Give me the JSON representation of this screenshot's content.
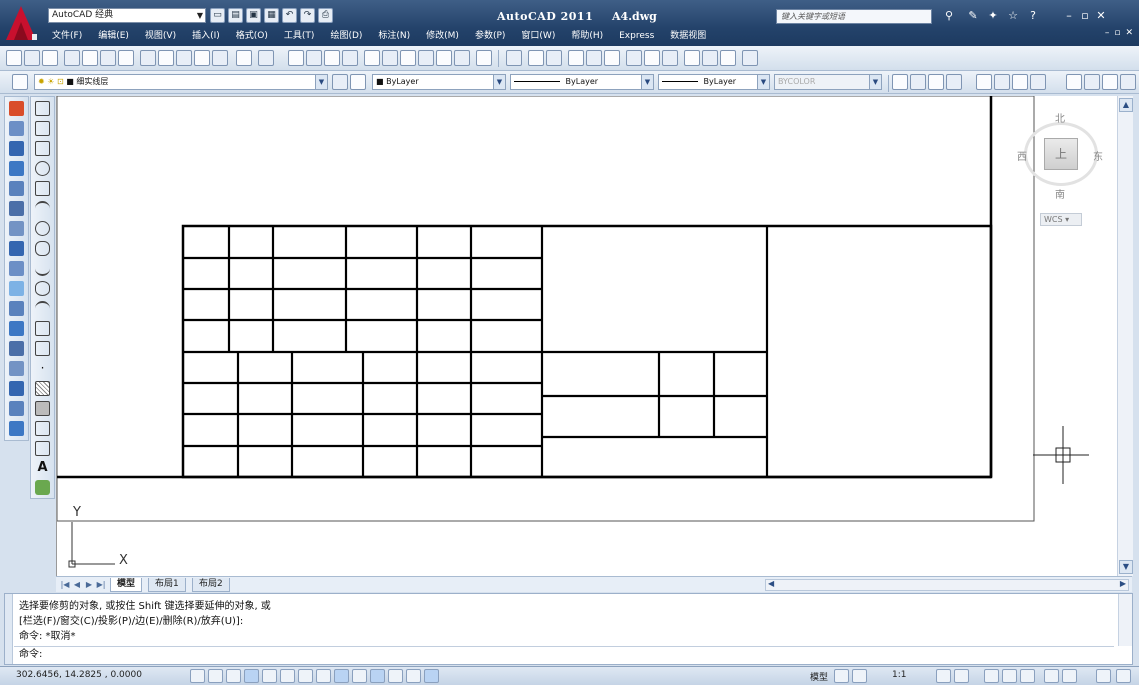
{
  "titlebar": {
    "app_title": "AutoCAD 2011",
    "file_name": "A4.dwg",
    "workspace": "AutoCAD 经典",
    "search_placeholder": "键入关键字或短语",
    "logo_icon": "autocad-logo-icon",
    "accent_color": "#24436b",
    "logo_color": "#c8102e"
  },
  "menu": {
    "items": [
      "文件(F)",
      "编辑(E)",
      "视图(V)",
      "插入(I)",
      "格式(O)",
      "工具(T)",
      "绘图(D)",
      "标注(N)",
      "修改(M)",
      "参数(P)",
      "窗口(W)",
      "帮助(H)",
      "Express",
      "数据视图"
    ]
  },
  "layers_toolbar": {
    "layer_name": "■ 细实线层",
    "color": "■ ByLayer",
    "linetype": "ByLayer",
    "lineweight": "ByLayer",
    "plotstyle": "BYCOLOR"
  },
  "viewcube": {
    "north": "北",
    "south": "南",
    "east": "东",
    "west": "西",
    "face": "上",
    "wcs": "WCS"
  },
  "ucs": {
    "x_label": "X",
    "y_label": "Y"
  },
  "tabs": {
    "items": [
      "模型",
      "布局1",
      "布局2"
    ],
    "active": "模型"
  },
  "command": {
    "line1": "选择要修剪的对象, 或按住 Shift 键选择要延伸的对象, 或",
    "line2": "[栏选(F)/窗交(C)/投影(P)/边(E)/删除(R)/放弃(U)]:",
    "line3": "命令: *取消*",
    "prompt": "命令:"
  },
  "statusbar": {
    "coordinates": "302.6456, 14.2825 , 0.0000",
    "model": "模型",
    "annotation_scale": "1:1"
  }
}
